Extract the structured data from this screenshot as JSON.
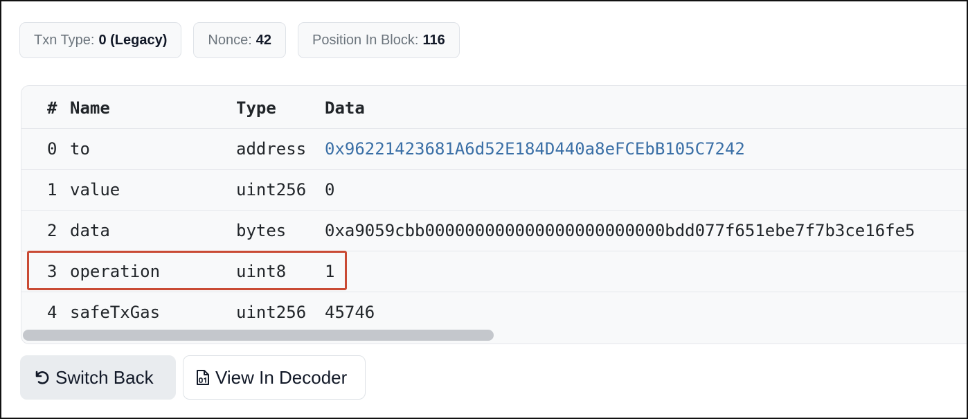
{
  "badges": {
    "txn_type": {
      "label": "Txn Type:",
      "value": "0 (Legacy)"
    },
    "nonce": {
      "label": "Nonce:",
      "value": "42"
    },
    "position": {
      "label": "Position In Block:",
      "value": "116"
    }
  },
  "table": {
    "columns": [
      "#",
      "Name",
      "Type",
      "Data"
    ],
    "rows": [
      {
        "index": "0",
        "name": "to",
        "type": "address",
        "data": "0x96221423681A6d52E184D440a8eFCEbB105C7242"
      },
      {
        "index": "1",
        "name": "value",
        "type": "uint256",
        "data": "0"
      },
      {
        "index": "2",
        "name": "data",
        "type": "bytes",
        "data": "0xa9059cbb000000000000000000000000bdd077f651ebe7f7b3ce16fe5"
      },
      {
        "index": "3",
        "name": "operation",
        "type": "uint8",
        "data": "1"
      },
      {
        "index": "4",
        "name": "safeTxGas",
        "type": "uint256",
        "data": "45746"
      }
    ]
  },
  "buttons": {
    "switch_back": "Switch Back",
    "view_in_decoder": "View In Decoder"
  },
  "colors": {
    "link": "#3a6fa6",
    "highlight": "#c94a34"
  },
  "icons": [
    "undo-arrow-icon",
    "binary-file-icon"
  ]
}
